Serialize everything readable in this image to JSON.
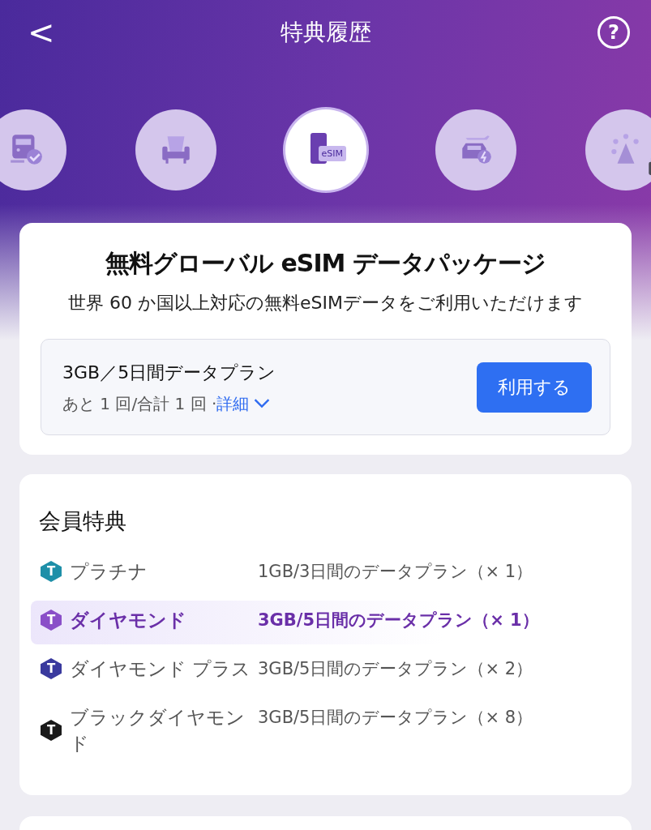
{
  "header": {
    "back": "<",
    "title": "特典履歴",
    "help": "?"
  },
  "categories": [
    {
      "kind": "train",
      "selected": false,
      "locked": false
    },
    {
      "kind": "seat",
      "selected": false,
      "locked": false
    },
    {
      "kind": "esim",
      "selected": true,
      "locked": false,
      "label": "eSIM"
    },
    {
      "kind": "car",
      "selected": false,
      "locked": false
    },
    {
      "kind": "tower",
      "selected": false,
      "locked": true
    }
  ],
  "offer": {
    "title": "無料グローバル eSIM データパッケージ",
    "subtitle": "世界 60 か国以上対応の無料eSIMデータをご利用いただけます",
    "plan": {
      "name": "3GB／5日間データプラン",
      "remaining": "あと 1 回/合計 1 回 · ",
      "details": "詳細",
      "button": "利用する"
    }
  },
  "benefits": {
    "title": "会員特典",
    "tiers": [
      {
        "name": "プラチナ",
        "badge": "T",
        "color": "#1e8fa8",
        "plan": "1GB/3日間のデータプラン（× 1）",
        "selected": false
      },
      {
        "name": "ダイヤモンド",
        "badge": "T",
        "color": "#8a4fc8",
        "plan": "3GB/5日間のデータプラン（× 1）",
        "selected": true
      },
      {
        "name": "ダイヤモンド プラス",
        "badge": "T",
        "color": "#3a3a9e",
        "plan": "3GB/5日間のデータプラン（× 2）",
        "selected": false
      },
      {
        "name": "ブラックダイヤモンド",
        "badge": "T",
        "color": "#1a1a1a",
        "plan": "3GB/5日間のデータプラン（× 8）",
        "selected": false
      }
    ]
  }
}
